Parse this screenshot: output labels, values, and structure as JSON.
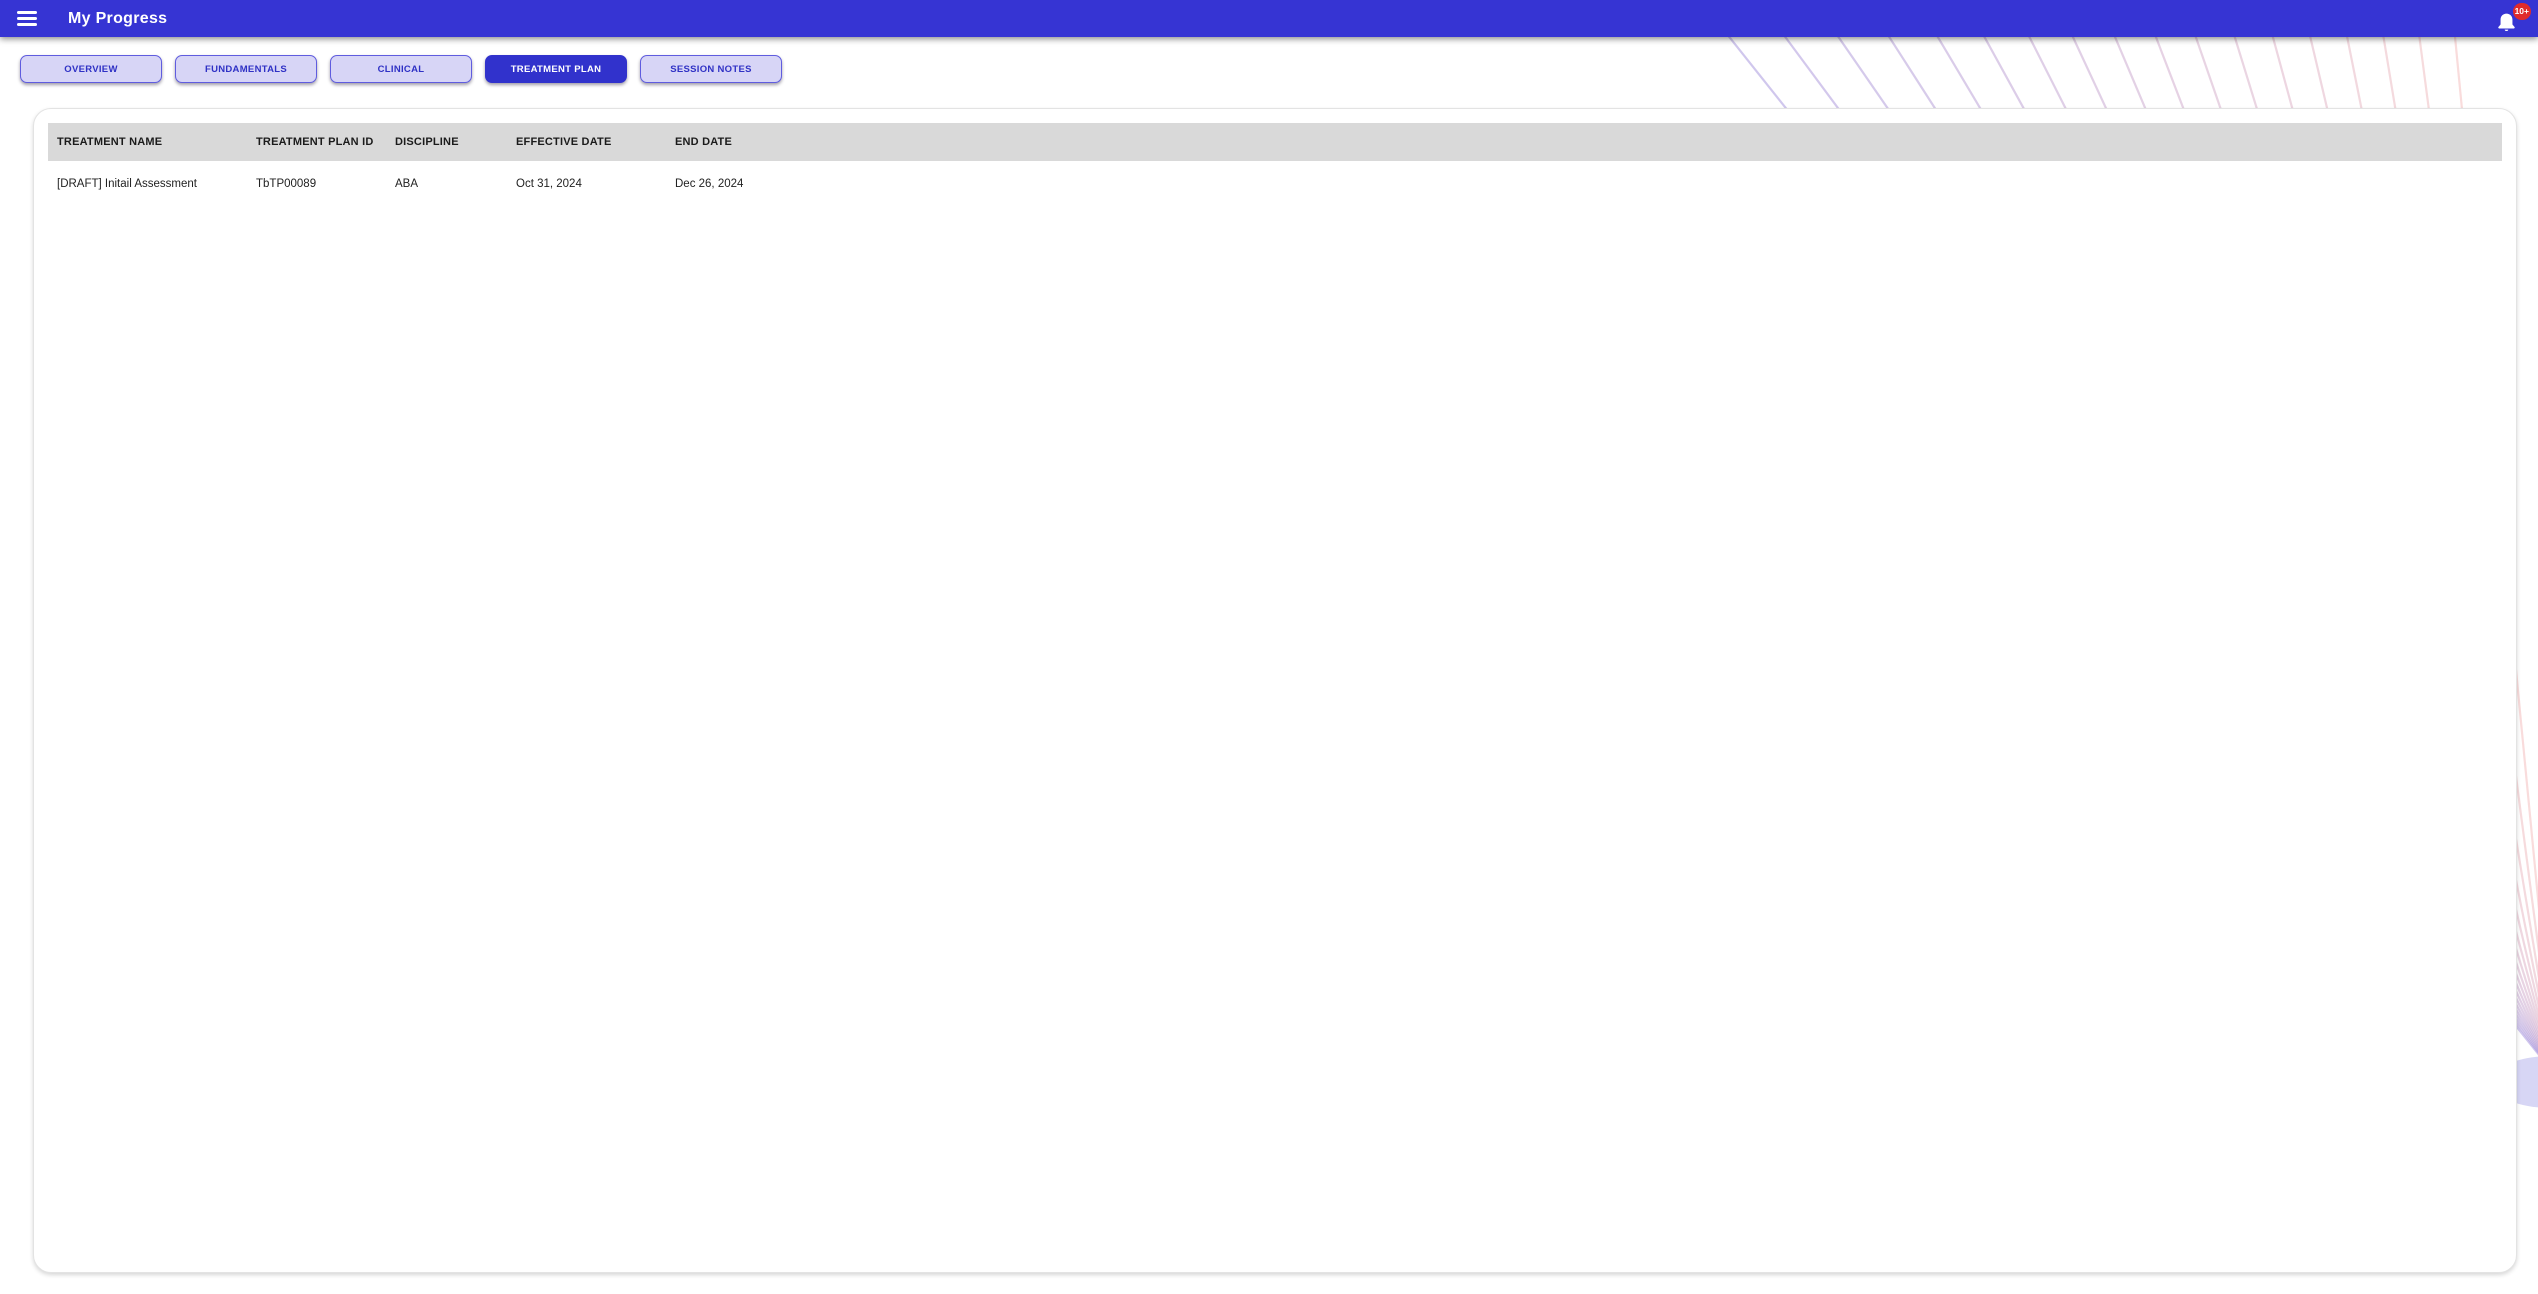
{
  "app_bar": {
    "title": "My Progress",
    "notification_count": "10+"
  },
  "colors": {
    "app_bar_bg": "#3634d3",
    "tab_active_bg": "#3132cc",
    "tab_inactive_bg": "#d7d5f6",
    "tab_border": "#5f5cdf",
    "tab_text": "#2f31c5",
    "table_header_bg": "#d9d9d9",
    "badge_red": "#e02b2b"
  },
  "tabs": [
    {
      "label": "OVERVIEW",
      "active": false
    },
    {
      "label": "FUNDAMENTALS",
      "active": false
    },
    {
      "label": "CLINICAL",
      "active": false
    },
    {
      "label": "TREATMENT PLAN",
      "active": true
    },
    {
      "label": "SESSION NOTES",
      "active": false
    }
  ],
  "table": {
    "columns": [
      "TREATMENT NAME",
      "TREATMENT PLAN ID",
      "DISCIPLINE",
      "EFFECTIVE DATE",
      "END DATE"
    ],
    "rows": [
      [
        "[DRAFT] Initail Assessment",
        "TbTP00089",
        "ABA",
        "Oct 31, 2024",
        "Dec 26, 2024"
      ]
    ]
  }
}
